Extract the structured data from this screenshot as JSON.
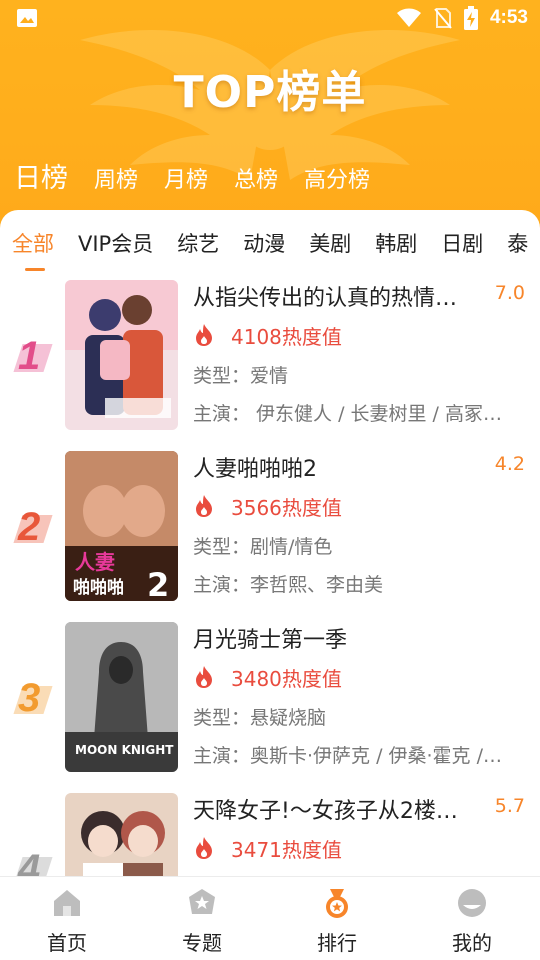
{
  "status_bar": {
    "time": "4:53",
    "icons": [
      "image-icon",
      "wifi-icon",
      "no-sim-icon",
      "battery-charging-icon"
    ]
  },
  "header": {
    "title": "TOP榜单",
    "period_tabs": [
      {
        "label": "日榜",
        "active": true
      },
      {
        "label": "周榜",
        "active": false
      },
      {
        "label": "月榜",
        "active": false
      },
      {
        "label": "总榜",
        "active": false
      },
      {
        "label": "高分榜",
        "active": false
      }
    ]
  },
  "categories": [
    {
      "label": "全部",
      "active": true
    },
    {
      "label": "VIP会员",
      "active": false
    },
    {
      "label": "综艺",
      "active": false
    },
    {
      "label": "动漫",
      "active": false
    },
    {
      "label": "美剧",
      "active": false
    },
    {
      "label": "韩剧",
      "active": false
    },
    {
      "label": "日剧",
      "active": false
    },
    {
      "label": "泰",
      "active": false
    }
  ],
  "items": [
    {
      "rank": "1",
      "rank_color": "#e24d8a",
      "title": "从指尖传出的认真的热情…",
      "score": "7.0",
      "heat": "4108热度值",
      "genre": "类型：爱情",
      "cast": "主演： 伊东健人 / 长妻树里 / 高冢…",
      "poster_colors": [
        "#f3b1c2",
        "#d9573a"
      ]
    },
    {
      "rank": "2",
      "rank_color": "#e8573a",
      "title": "人妻啪啪啪2",
      "score": "4.2",
      "heat": "3566热度值",
      "genre": "类型：剧情/情色",
      "cast": "主演：李哲熙、李由美",
      "poster_colors": [
        "#c58a68",
        "#6b3e2c"
      ]
    },
    {
      "rank": "3",
      "rank_color": "#f29b2f",
      "title": "月光骑士第一季",
      "score": "",
      "heat": "3480热度值",
      "genre": "类型：悬疑烧脑",
      "cast": "主演：奥斯卡·伊萨克 / 伊桑·霍克 /…",
      "poster_colors": [
        "#b8b8b8",
        "#4a4a4a"
      ]
    },
    {
      "rank": "4",
      "rank_color": "#9a9a9a",
      "title": "天降女子!～女孩子从2楼……",
      "score": "5.7",
      "heat": "3471热度值",
      "genre": "",
      "cast": "",
      "poster_colors": [
        "#e8d3c3",
        "#8b5a4a"
      ]
    }
  ],
  "bottom_nav": [
    {
      "label": "首页",
      "icon": "home-icon",
      "active": false
    },
    {
      "label": "专题",
      "icon": "topic-badge-icon",
      "active": false
    },
    {
      "label": "排行",
      "icon": "medal-icon",
      "active": true
    },
    {
      "label": "我的",
      "icon": "profile-icon",
      "active": false
    }
  ],
  "colors": {
    "header": "#ffae1c",
    "accent": "#f7852a",
    "heat": "#e94c3e"
  }
}
